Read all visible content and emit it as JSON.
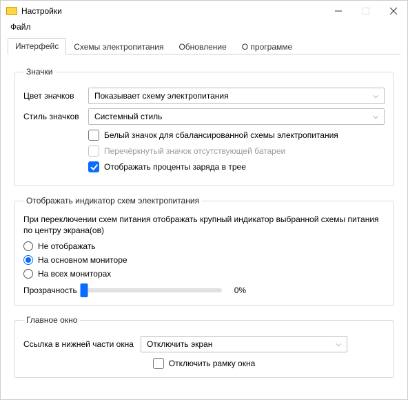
{
  "title": "Настройки",
  "menubar": {
    "file": "Файл"
  },
  "tabs": [
    {
      "label": "Интерфейс"
    },
    {
      "label": "Схемы электропитания"
    },
    {
      "label": "Обновление"
    },
    {
      "label": "О программе"
    }
  ],
  "icons_group": {
    "legend": "Значки",
    "color_label": "Цвет значков",
    "color_value": "Показывает схему электропитания",
    "style_label": "Стиль значков",
    "style_value": "Системный стиль",
    "white_icon": "Белый значок для сбалансированной схемы электропитания",
    "strike_icon": "Перечёркнутый значок отсутствующей батареи",
    "show_percent": "Отображать проценты заряда в трее"
  },
  "indicator_group": {
    "legend": "Отображать индикатор схем электропитания",
    "help": "При переключении схем питания отображать крупный индикатор выбранной схемы питания по центру экрана(ов)",
    "opt_none": "Не отображать",
    "opt_primary": "На основном мониторе",
    "opt_all": "На всех мониторах",
    "opacity_label": "Прозрачность",
    "opacity_value": "0%"
  },
  "mainwin_group": {
    "legend": "Главное окно",
    "link_label": "Ссылка в нижней части окна",
    "link_value": "Отключить экран",
    "borderless": "Отключить рамку окна"
  }
}
